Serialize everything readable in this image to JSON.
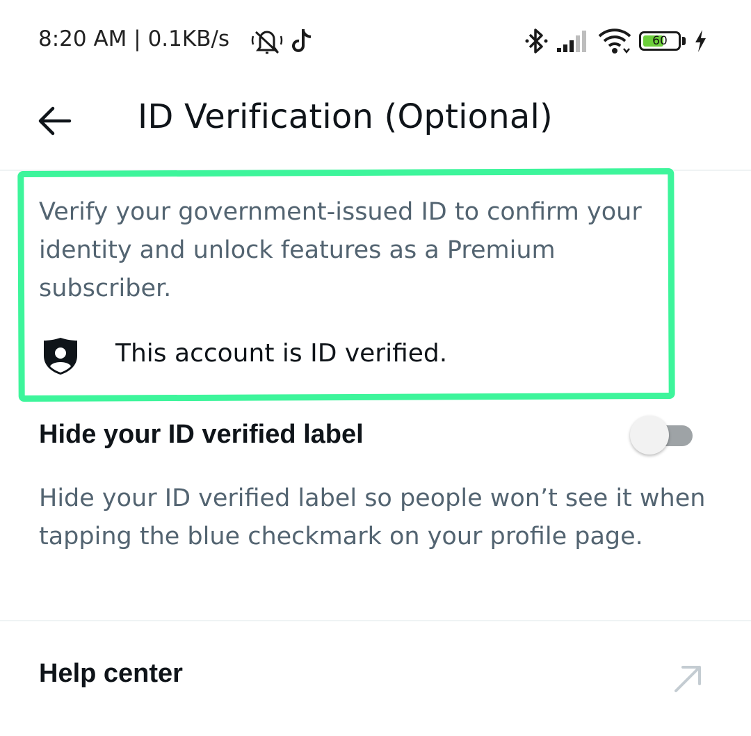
{
  "status_bar": {
    "time_speed": "8:20 AM | 0.1KB/s",
    "icons": [
      "muted-bell-icon",
      "tiktok-icon",
      "bluetooth-icon",
      "signal-icon",
      "wifi-icon",
      "battery-icon",
      "charging-icon"
    ],
    "battery_level": "60",
    "battery_color": "#6ccf3a"
  },
  "header": {
    "title": "ID Verification (Optional)",
    "back_icon": "back-arrow-icon"
  },
  "verification": {
    "description": "Verify your government-issued ID to confirm your identity and unlock features as a Premium subscriber.",
    "status_text": "This account is ID verified.",
    "status_icon": "id-shield-icon",
    "highlight_color": "#3df59b"
  },
  "hide_label_setting": {
    "label": "Hide your ID verified label",
    "enabled": false,
    "description": "Hide your ID verified label so people won’t see it when tapping the blue checkmark on your profile page."
  },
  "help": {
    "label": "Help center",
    "icon": "external-link-arrow-icon"
  }
}
